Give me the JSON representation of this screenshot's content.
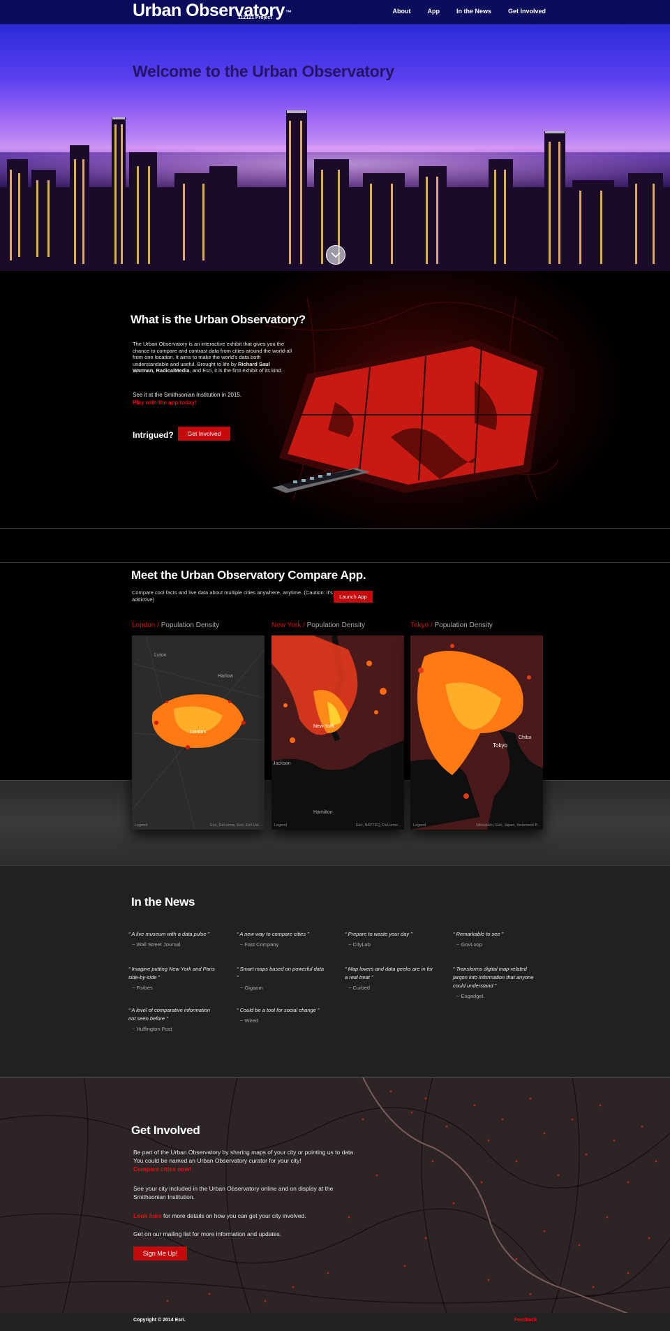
{
  "header": {
    "logo": "Urban Observatory",
    "logo_tm": "™",
    "logo_sub": "112121 Project",
    "nav": [
      "About",
      "App",
      "In the News",
      "Get Involved"
    ]
  },
  "hero": {
    "title": "Welcome to the Urban Observatory"
  },
  "what": {
    "title": "What is the Urban Observatory?",
    "paragraph_a": "The Urban Observatory is an interactive exhibit that gives you the chance to compare and contrast data from cities around the world-all from one location.  It aims to make the world's data both understandable and useful.  Brought to life by ",
    "paragraph_bold": "Richard Saul Warman, RadicalMedia",
    "paragraph_b": ", and Esri, it is the first exhibit of its kind.",
    "smithsonian": "See it at the Smithsonian Institution in 2015.",
    "play_link": "Play with the app today!",
    "intrigued": "Intrigued?",
    "get_involved_btn": "Get Involved"
  },
  "compare": {
    "title": "Meet the Urban Observatory Compare App.",
    "desc": "Compare cool facts and live data about multiple cities anywhere, anytime. (Caution:  it's addictive)",
    "launch_btn": "Launch App",
    "maps": [
      {
        "city": "London",
        "sep": " / ",
        "metric": "Population Density",
        "legend": "Legend",
        "credit": "Esri, DeLorme, Esri, Esri Ltd..."
      },
      {
        "city": "New York",
        "sep": " / ",
        "metric": "Population Density",
        "legend": "Legend",
        "credit": "Esri, NAVTEQ, DeLorme..."
      },
      {
        "city": "Tokyo",
        "sep": " / ",
        "metric": "Population Density",
        "legend": "Legend",
        "credit": "Mitsubishi, Esri, Japan, Increment P..."
      }
    ],
    "map_places": {
      "luton": "Luton",
      "harlow": "Harlow",
      "london": "London",
      "new_york": "New York",
      "hamilton": "Hamilton",
      "jackson": "Jackson",
      "tokyo": "Tokyo",
      "chiba": "Chiba"
    }
  },
  "news": {
    "title": "In the News",
    "quotes": [
      {
        "text": "A live museum with a data pulse",
        "src": "~ Wall Street Journal"
      },
      {
        "text": "A new way to compare cities",
        "src": "~ Fast Company"
      },
      {
        "text": "Prepare to waste your day",
        "src": "~ CityLab"
      },
      {
        "text": "Remarkable to see",
        "src": "~ GovLoop"
      },
      {
        "text": "Imagine putting New York and Paris side-by-side",
        "src": "~ Forbes"
      },
      {
        "text": "Smart maps based on powerful data",
        "src": "~ Gigaom"
      },
      {
        "text": "Map lovers and data geeks are in for a real treat",
        "src": "~ Curbed"
      },
      {
        "text": "Transforms digital map-related jargon into information that anyone could understand",
        "src": "~ Engadget"
      },
      {
        "text": "A level of comparative information not seen before",
        "src": "~ Huffington Post"
      },
      {
        "text": "Could be a tool for social change",
        "src": "~ Wired"
      }
    ]
  },
  "get_involved": {
    "title": "Get Involved",
    "p1": "Be part of the Urban Observatory by sharing maps of your city or pointing us to data. You could be named an Urban Observatory curator for your city!",
    "p1_link": "Compare cities now!",
    "p2": "See your city included in the Urban Observatory online and on display at the Smithsonian Institution.",
    "p3_link": "Look here",
    "p3": " for more details on how you can get your city involved.",
    "p4": "Get on our mailing list for more information and updates.",
    "signup_btn": "Sign Me Up!"
  },
  "footer": {
    "copyright": "Copyright © 2014 Esri.",
    "feedback": "Feedback"
  }
}
